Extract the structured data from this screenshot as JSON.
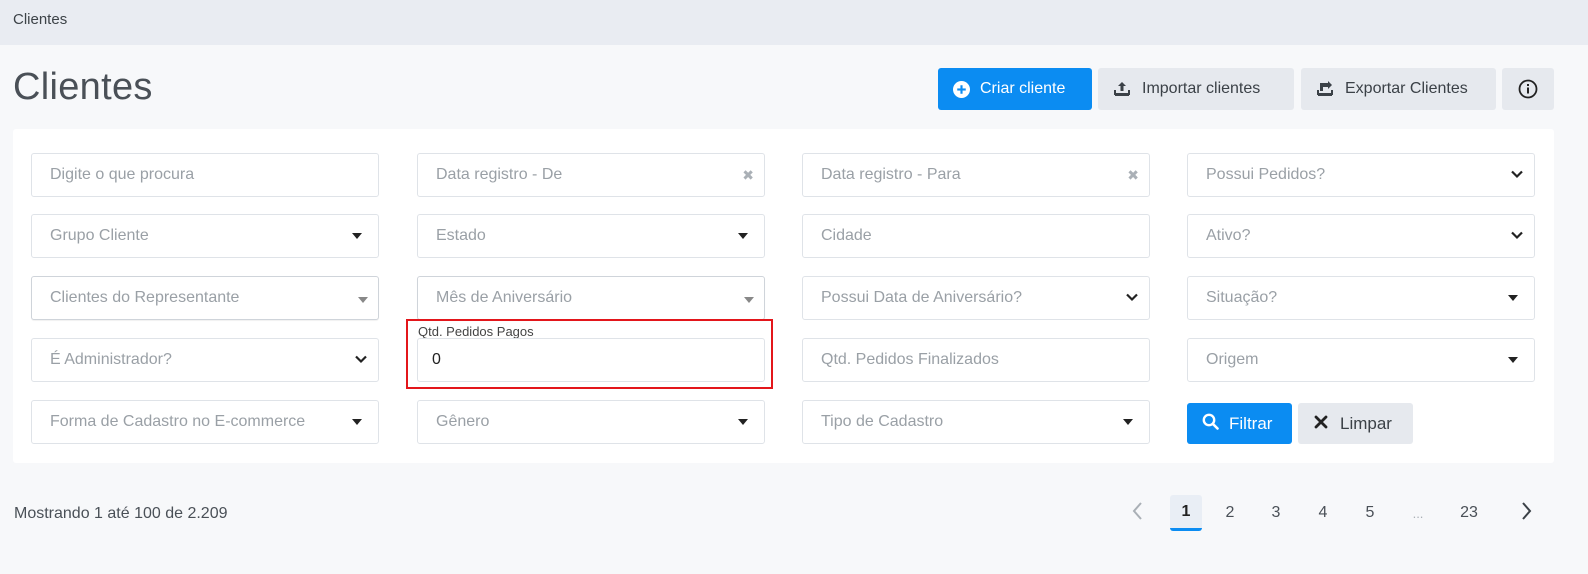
{
  "breadcrumb": "Clientes",
  "title": "Clientes",
  "actions": {
    "create": "Criar cliente",
    "import": "Importar clientes",
    "export": "Exportar Clientes"
  },
  "filters": {
    "search": "Digite o que procura",
    "date_from": "Data registro - De",
    "date_to": "Data registro - Para",
    "has_orders": "Possui Pedidos?",
    "client_group": "Grupo Cliente",
    "state": "Estado",
    "city": "Cidade",
    "active": "Ativo?",
    "rep_clients": "Clientes do Representante",
    "birth_month": "Mês de Aniversário",
    "has_birthdate": "Possui Data de Aniversário?",
    "status": "Situação?",
    "is_admin": "É Administrador?",
    "paid_orders_label": "Qtd. Pedidos Pagos",
    "paid_orders_value": "0",
    "finished_orders": "Qtd. Pedidos Finalizados",
    "origin": "Origem",
    "signup_form": "Forma de Cadastro no E-commerce",
    "gender": "Gênero",
    "signup_type": "Tipo de Cadastro",
    "filter_btn": "Filtrar",
    "clear_btn": "Limpar"
  },
  "results": {
    "showing": "Mostrando 1 até 100 de 2.209"
  },
  "pagination": {
    "pages": [
      "1",
      "2",
      "3",
      "4",
      "5",
      "...",
      "23"
    ],
    "current": "1"
  },
  "colors": {
    "primary": "#0b8cf2",
    "highlight": "#e3161b"
  },
  "icons": [
    "plus-circle-icon",
    "upload-tray-icon",
    "download-tray-icon",
    "info-icon",
    "search-icon",
    "close-x-icon",
    "chevron-left-icon",
    "chevron-right-icon"
  ]
}
